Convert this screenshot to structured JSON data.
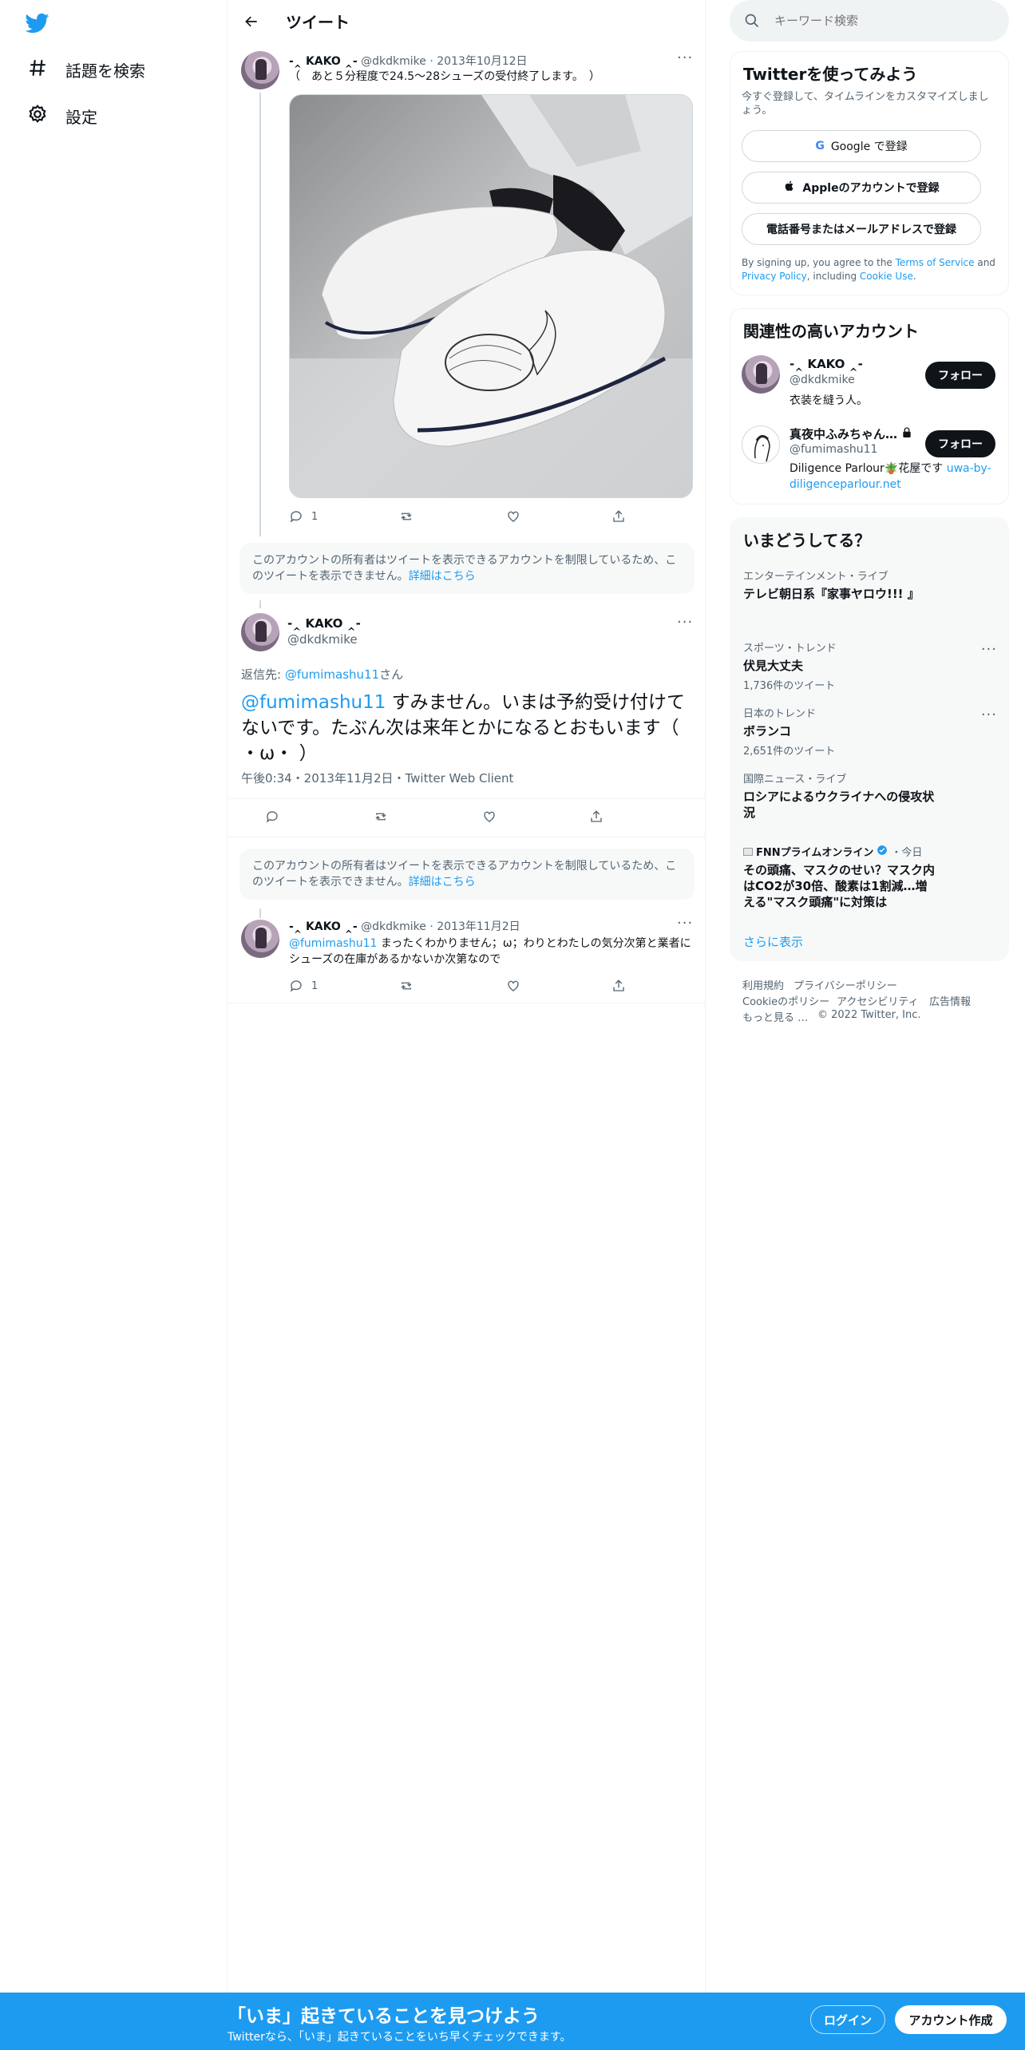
{
  "nav": {
    "explore_label": "話題を検索",
    "settings_label": "設定"
  },
  "header": {
    "title": "ツイート"
  },
  "tweet1": {
    "name": "-‸ KAKO ‸-",
    "handle": "@dkdkmike",
    "date": "2013年10月12日",
    "text": "（　あと５分程度で24.5〜28シューズの受付終了します。　）",
    "reply_count": "1"
  },
  "notice": {
    "text": "このアカウントの所有者はツイートを表示できるアカウントを制限しているため、このツイートを表示できません。",
    "link": "詳細はこちら"
  },
  "main_tweet": {
    "name": "-‸ KAKO ‸-",
    "handle": "@dkdkmike",
    "reply_prefix": "返信先: ",
    "reply_to": "@fumimashu11",
    "reply_suffix": "さん",
    "mention": "@fumimashu11",
    "text": " すみません。いまは予約受け付けてないです。たぶん次は来年とかになるとおもいます（ ・ω・ ）",
    "meta": "午後0:34・2013年11月2日・Twitter Web Client"
  },
  "tweet3": {
    "name": "-‸ KAKO ‸-",
    "handle": "@dkdkmike",
    "date": "2013年11月2日",
    "mention": "@fumimashu11",
    "text": " まったくわかりません；ω；わりとわたしの気分次第と業者にシューズの在庫があるかないか次第なので",
    "reply_count": "1"
  },
  "search": {
    "placeholder": "キーワード検索"
  },
  "signup_card": {
    "title": "Twitterを使ってみよう",
    "subtitle": "今すぐ登録して、タイムラインをカスタマイズしましょう。",
    "google": "Google で登録",
    "apple": "Appleのアカウントで登録",
    "phone": "電話番号またはメールアドレスで登録",
    "terms_prefix": "By signing up, you agree to the ",
    "terms": "Terms of Service",
    "and": " and ",
    "privacy": "Privacy Policy",
    "including": ", including ",
    "cookie": "Cookie Use",
    "period": "."
  },
  "related": {
    "title": "関連性の高いアカウント",
    "follow_label": "フォロー",
    "accounts": [
      {
        "name": "-‸ KAKO ‸-",
        "handle": "@dkdkmike",
        "bio": "衣装を縫う人。"
      },
      {
        "name": "真夜中ふみちゃん…",
        "handle": "@fumimashu11",
        "bio": "Diligence Parlour🪴花屋です ",
        "link": "uwa-by-diligenceparlour.net"
      }
    ]
  },
  "trends": {
    "title": "いまどうしてる？",
    "items": [
      {
        "category": "エンターテインメント・ライブ",
        "title": "テレビ朝日系『家事ヤロウ!!! 』",
        "count": ""
      },
      {
        "category": "スポーツ・トレンド",
        "title": "伏見大丈夫",
        "count": "1,736件のツイート"
      },
      {
        "category": "日本のトレンド",
        "title": "ボランコ",
        "count": "2,651件のツイート"
      },
      {
        "category": "国際ニュース・ライブ",
        "title": "ロシアによるウクライナへの侵攻状況",
        "count": ""
      },
      {
        "category": "FNNプライムオンライン",
        "meta": "・今日",
        "title": "その頭痛、マスクのせい？マスク内はCO2が30倍、酸素は1割減…増える\"マスク頭痛\"に対策は",
        "count": ""
      }
    ],
    "show_more": "さらに表示"
  },
  "footer": {
    "terms": "利用規約",
    "privacy": "プライバシーポリシー",
    "cookie": "Cookieのポリシー",
    "accessibility": "アクセシビリティ",
    "ads": "広告情報",
    "more": "もっと見る …",
    "copyright": "© 2022 Twitter, Inc."
  },
  "bottom_bar": {
    "title": "「いま」起きていることを見つけよう",
    "subtitle": "Twitterなら、「いま」起きていることをいち早くチェックできます。",
    "login": "ログイン",
    "signup": "アカウント作成"
  },
  "colors": {
    "brand": "#1d9bf0",
    "text": "#0f1419",
    "muted": "#536471"
  }
}
